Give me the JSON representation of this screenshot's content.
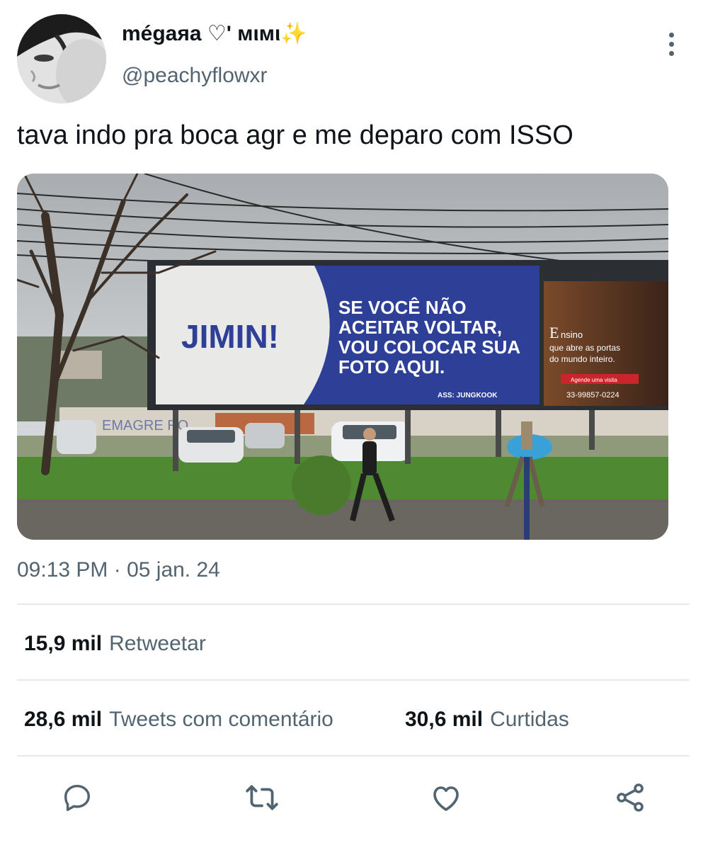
{
  "author": {
    "display_name": "mégaяa ♡' мιмι✨",
    "handle": "@peachyflowxr"
  },
  "tweet": {
    "text": "tava indo pra boca agr e me deparo com ISSO",
    "timestamp": "09:13 PM · 05 jan. 24"
  },
  "media": {
    "billboard": {
      "name": "JIMIN!",
      "line1": "SE VOCÊ NÃO",
      "line2": "ACEITAR VOLTAR,",
      "line3": "VOU COLOCAR SUA",
      "line4": "FOTO AQUI.",
      "signature": "ASS: JUNGKOOK"
    },
    "side_ad": {
      "title_initial": "E",
      "title_rest": "nsino",
      "line1": "que abre as portas",
      "line2": "do mundo inteiro.",
      "button": "Agende uma visita",
      "phone": "33-99857-0224"
    },
    "wall_graffiti": "EMAGRE      RO"
  },
  "stats": {
    "retweets": {
      "count": "15,9 mil",
      "label": "Retweetar"
    },
    "quotes": {
      "count": "28,6 mil",
      "label": "Tweets com comentário"
    },
    "likes": {
      "count": "30,6 mil",
      "label": "Curtidas"
    }
  },
  "actions": [
    "reply-icon",
    "retweet-icon",
    "like-icon",
    "share-icon"
  ],
  "colors": {
    "text": "#0f1419",
    "secondary": "#536471",
    "divider": "#e6e9eb",
    "billboard_blue": "#2d3f96"
  }
}
